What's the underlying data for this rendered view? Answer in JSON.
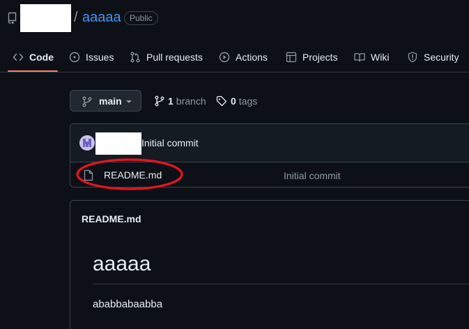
{
  "repo": {
    "separator": "/",
    "name": "aaaaa",
    "visibility": "Public"
  },
  "tabs": [
    {
      "label": "Code",
      "icon": "code-icon",
      "active": true
    },
    {
      "label": "Issues",
      "icon": "issue-icon"
    },
    {
      "label": "Pull requests",
      "icon": "pull-request-icon"
    },
    {
      "label": "Actions",
      "icon": "play-icon"
    },
    {
      "label": "Projects",
      "icon": "table-icon"
    },
    {
      "label": "Wiki",
      "icon": "book-icon"
    },
    {
      "label": "Security",
      "icon": "shield-icon"
    }
  ],
  "branch": {
    "current": "main",
    "branch_count": "1",
    "branch_label": "branch",
    "tag_count": "0",
    "tag_label": "tags"
  },
  "latest_commit": {
    "message": "Initial commit"
  },
  "files": [
    {
      "name": "README.md",
      "commit_message": "Initial commit"
    }
  ],
  "readme": {
    "title": "README.md",
    "heading": "aaaaa",
    "body": "ababbabaabba"
  },
  "colors": {
    "background": "#0d1117",
    "link": "#4493f8",
    "active_tab_underline": "#f78166",
    "annotation": "#e8141e"
  }
}
